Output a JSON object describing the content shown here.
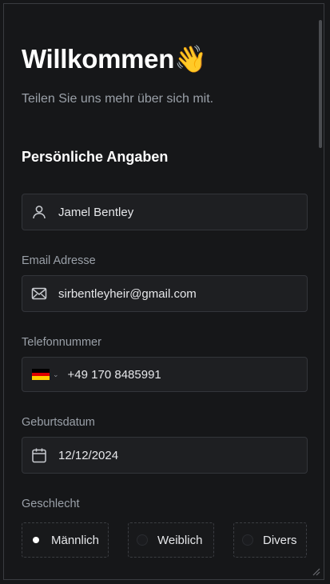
{
  "header": {
    "title": "Willkommen",
    "wave_emoji": "👋",
    "subtitle": "Teilen Sie uns mehr über sich mit."
  },
  "section": {
    "title": "Persönliche Angaben"
  },
  "form": {
    "name": {
      "value": "Jamel Bentley",
      "icon": "user-icon"
    },
    "email": {
      "label": "Email Adresse",
      "value": "sirbentleyheir@gmail.com",
      "icon": "mail-icon"
    },
    "phone": {
      "label": "Telefonnummer",
      "value": "+49 170 8485991",
      "country_flag": "de-flag-icon"
    },
    "birthdate": {
      "label": "Geburtsdatum",
      "value": "12/12/2024",
      "icon": "calendar-icon"
    },
    "gender": {
      "label": "Geschlecht",
      "options": [
        {
          "label": "Männlich",
          "selected": true
        },
        {
          "label": "Weiblich",
          "selected": false
        },
        {
          "label": "Divers",
          "selected": false
        }
      ]
    }
  },
  "colors": {
    "background": "#161719",
    "input_bg": "#1e1f22",
    "input_border": "#33353a",
    "label": "#9aa0a8",
    "text": "#e6e7ea"
  }
}
